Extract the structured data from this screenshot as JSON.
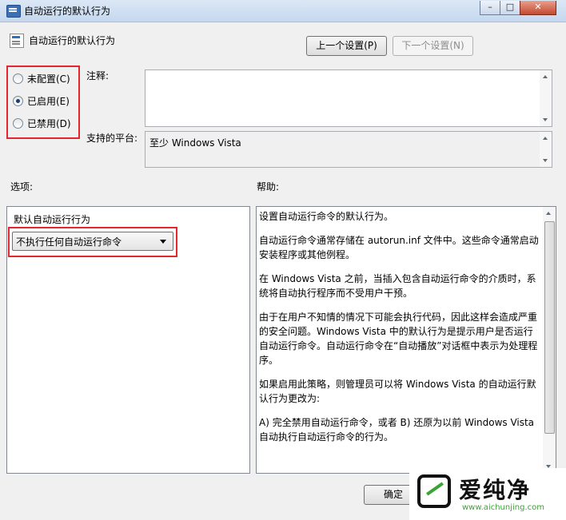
{
  "window": {
    "title": "自动运行的默认行为",
    "minimize_glyph": "–",
    "maximize_glyph": "□",
    "close_glyph": "✕"
  },
  "header": {
    "title": "自动运行的默认行为",
    "prev_button": "上一个设置(P)",
    "next_button": "下一个设置(N)"
  },
  "state": {
    "options": [
      {
        "label": "未配置(C)",
        "checked": false
      },
      {
        "label": "已启用(E)",
        "checked": true
      },
      {
        "label": "已禁用(D)",
        "checked": false
      }
    ]
  },
  "comment": {
    "label": "注释:",
    "value": ""
  },
  "platform": {
    "label": "支持的平台:",
    "value": "至少 Windows Vista"
  },
  "options_section": {
    "label": "选项:",
    "field_label": "默认自动运行行为",
    "selected": "不执行任何自动运行命令"
  },
  "help_section": {
    "label": "帮助:",
    "paragraphs": [
      "设置自动运行命令的默认行为。",
      "自动运行命令通常存储在 autorun.inf 文件中。这些命令通常启动安装程序或其他例程。",
      "在 Windows Vista 之前，当插入包含自动运行命令的介质时，系统将自动执行程序而不受用户干预。",
      "由于在用户不知情的情况下可能会执行代码，因此这样会造成严重的安全问题。Windows Vista 中的默认行为是提示用户是否运行自动运行命令。自动运行命令在“自动播放”对话框中表示为处理程序。",
      "如果启用此策略，则管理员可以将 Windows Vista 的自动运行默认行为更改为:",
      "A) 完全禁用自动运行命令，或者 B) 还原为以前 Windows Vista 自动执行自动运行命令的行为。"
    ]
  },
  "footer": {
    "ok_button": "确定"
  },
  "watermark": {
    "text": "爱纯净",
    "url": "www.aichunjing.com"
  },
  "colors": {
    "highlight_box": "#e0282e",
    "watermark_green": "#3aa335"
  }
}
